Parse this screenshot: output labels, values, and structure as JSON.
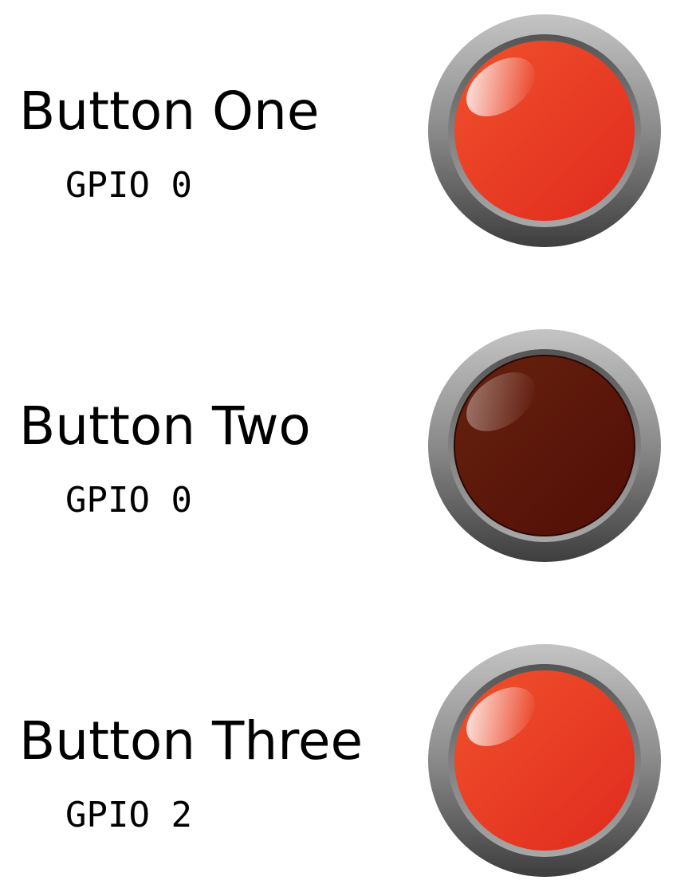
{
  "buttons": [
    {
      "label": "Button One",
      "gpio": "GPIO 0",
      "state": "on",
      "color_face": "#e8402a",
      "color_face_dark": "#e02a1c"
    },
    {
      "label": "Button Two",
      "gpio": "GPIO 0",
      "state": "off",
      "color_face": "#5e1a0c",
      "color_face_dark": "#4e0e06"
    },
    {
      "label": "Button Three",
      "gpio": "GPIO 2",
      "state": "on",
      "color_face": "#e8402a",
      "color_face_dark": "#e02a1c"
    }
  ]
}
